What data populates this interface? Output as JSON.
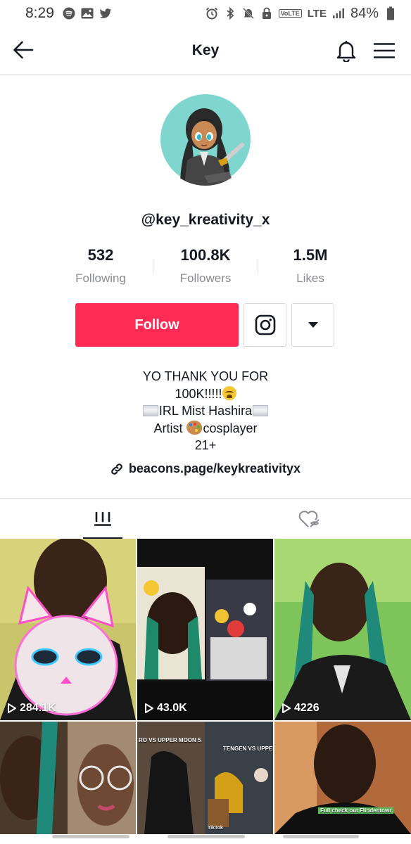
{
  "status_bar": {
    "time": "8:29",
    "left_icons": [
      "spotify-icon",
      "gallery-icon",
      "twitter-icon"
    ],
    "right_icons": [
      "alarm-icon",
      "bluetooth-icon",
      "mute-icon",
      "lock-icon",
      "volte-icon",
      "signal-icon",
      "battery-icon"
    ],
    "volte": "VoLTE",
    "network": "LTE",
    "battery": "84%"
  },
  "header": {
    "title": "Key",
    "back_icon": "arrow-left-icon",
    "bell_icon": "bell-icon",
    "menu_icon": "hamburger-menu-icon"
  },
  "profile": {
    "username": "@key_kreativity_x",
    "stats": [
      {
        "value": "532",
        "label": "Following"
      },
      {
        "value": "100.8K",
        "label": "Followers"
      },
      {
        "value": "1.5M",
        "label": "Likes"
      }
    ],
    "follow_label": "Follow",
    "bio": {
      "line1": "YO THANK YOU FOR",
      "line2": "100K!!!!!",
      "line3": "IRL Mist Hashira",
      "line4_a": "Artist ",
      "line4_b": "cosplayer",
      "line5": "21+"
    },
    "link": "beacons.page/keykreativityx"
  },
  "tabs": [
    {
      "icon": "videos-grid-icon",
      "active": true
    },
    {
      "icon": "liked-hidden-icon",
      "active": false
    }
  ],
  "videos": [
    {
      "views": "284.1K"
    },
    {
      "views": "43.0K"
    },
    {
      "views": "4226"
    },
    {
      "views": ""
    },
    {
      "views": "",
      "caption_a": "RO VS UPPER MOON 5",
      "caption_b": "TENGEN VS UPPER M",
      "watermark": "TikTok"
    },
    {
      "views": "",
      "caption": "Full check out Flindentowr"
    }
  ],
  "colors": {
    "accent": "#fe2c55",
    "text": "#161823",
    "secondary": "#8a8b91"
  }
}
